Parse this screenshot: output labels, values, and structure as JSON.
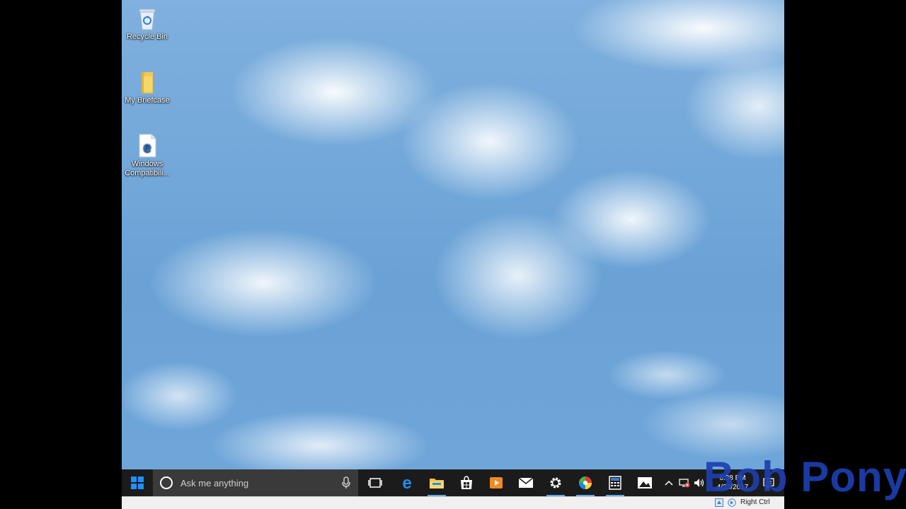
{
  "desktop": {
    "icons": [
      {
        "label": "Recycle Bin",
        "icon": "recycle-bin-icon"
      },
      {
        "label": "My Briefcase",
        "icon": "folder-icon"
      },
      {
        "label": "Windows Compatibili...",
        "icon": "edge-icon"
      }
    ]
  },
  "taskbar": {
    "search_placeholder": "Ask me anything",
    "pinned": [
      {
        "name": "Task View",
        "icon": "task-view-icon"
      },
      {
        "name": "Microsoft Edge",
        "icon": "edge-icon"
      },
      {
        "name": "File Explorer",
        "icon": "file-explorer-icon"
      },
      {
        "name": "Store",
        "icon": "store-icon"
      },
      {
        "name": "Media Player",
        "icon": "media-player-icon"
      },
      {
        "name": "Mail",
        "icon": "mail-icon"
      },
      {
        "name": "Settings",
        "icon": "gear-icon"
      },
      {
        "name": "Color app",
        "icon": "color-wheel-icon"
      },
      {
        "name": "Calculator",
        "icon": "calculator-icon"
      },
      {
        "name": "Photos",
        "icon": "photos-icon"
      }
    ],
    "tray": {
      "time": "6:38 PM",
      "date": "4/23/2017"
    }
  },
  "vm_statusbar": {
    "host_key": "Right Ctrl"
  },
  "watermark": "Bob Pony"
}
